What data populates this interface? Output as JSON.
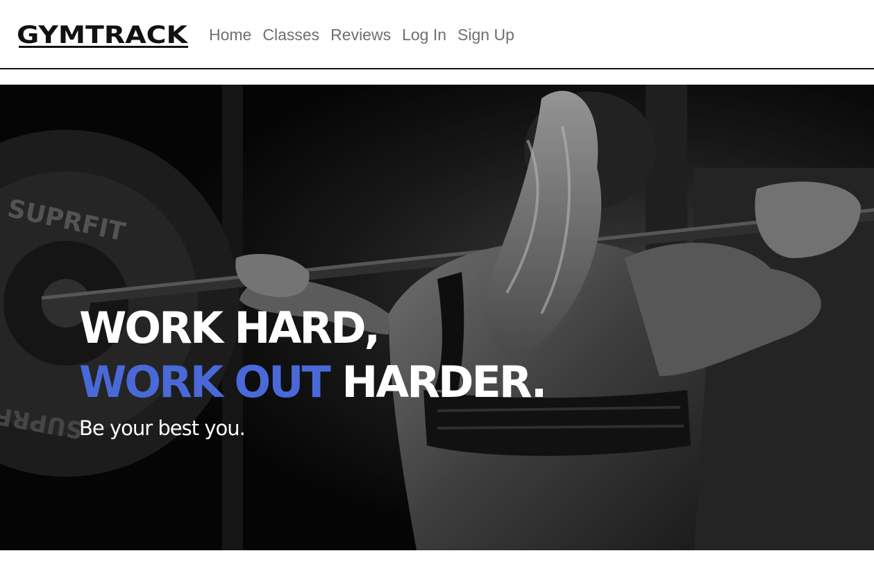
{
  "brand": {
    "logo_text": "GYMTRACK"
  },
  "nav": {
    "items": [
      {
        "label": "Home"
      },
      {
        "label": "Classes"
      },
      {
        "label": "Reviews"
      },
      {
        "label": "Log In"
      },
      {
        "label": "Sign Up"
      }
    ]
  },
  "hero": {
    "image_label": "hero photo",
    "plate_text_top": "SUPRFIT",
    "plate_text_bottom": "SUPRFIT",
    "line1": "WORK HARD,",
    "line2_accent": "WORK OUT",
    "line2_rest": " HARDER.",
    "tagline": "Be your best you."
  },
  "colors": {
    "accent": "#4a69d8",
    "nav_text": "#6f6f6f",
    "border": "#111111"
  }
}
